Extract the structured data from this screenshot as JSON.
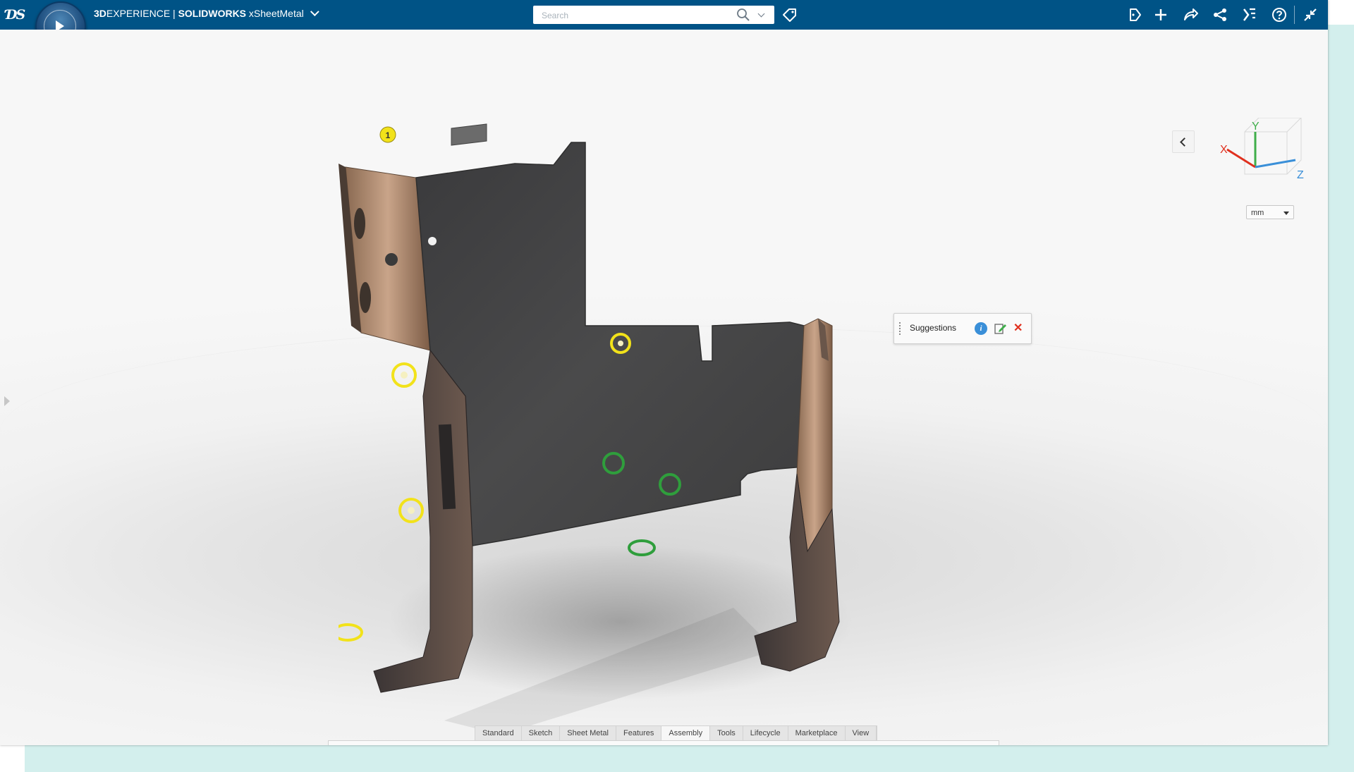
{
  "app": {
    "brand_bold": "3D",
    "brand_rest": "EXPERIENCE",
    "separator": " | ",
    "product_bold": "SOLIDWORKS",
    "product_rest": " xSheetMetal"
  },
  "search": {
    "placeholder": "Search"
  },
  "topbar_icons": [
    "tag-icon",
    "notifications-icon",
    "add-icon",
    "share-icon",
    "network-icon",
    "app-options-icon",
    "help-icon",
    "collapse-icon"
  ],
  "viewport": {
    "triad_labels": {
      "x": "X",
      "y": "Y",
      "z": "Z"
    },
    "units_value": "mm"
  },
  "suggestions_panel": {
    "title": "Suggestions"
  },
  "part": {
    "marker_number": "1"
  },
  "tabs": [
    {
      "label": "Standard",
      "active": false
    },
    {
      "label": "Sketch",
      "active": false
    },
    {
      "label": "Sheet Metal",
      "active": false
    },
    {
      "label": "Features",
      "active": false
    },
    {
      "label": "Assembly",
      "active": true
    },
    {
      "label": "Tools",
      "active": false
    },
    {
      "label": "Lifecycle",
      "active": false
    },
    {
      "label": "Marketplace",
      "active": false
    },
    {
      "label": "View",
      "active": false
    }
  ],
  "toolbar_icons": [
    "select-icon",
    "new-icon",
    "save-icon",
    "rebuild-icon",
    "open-icon",
    "settings-icon",
    "undo-icon",
    "redo-icon",
    "help-icon",
    "mate-icon",
    "insert-component-icon",
    "copy-component-icon",
    "pattern-icon",
    "explode-icon",
    "move-component-icon",
    "rotate-component-icon",
    "link-icon",
    "interference-icon",
    "smart-fastener-icon",
    "mirror-component-icon",
    "assembly-features-icon"
  ],
  "colors": {
    "topbar": "#005386",
    "accent_teal": "#d3efed",
    "marker_yellow": "#f2e21a",
    "marker_green": "#2f9e3c",
    "close_red": "#e0301e"
  }
}
